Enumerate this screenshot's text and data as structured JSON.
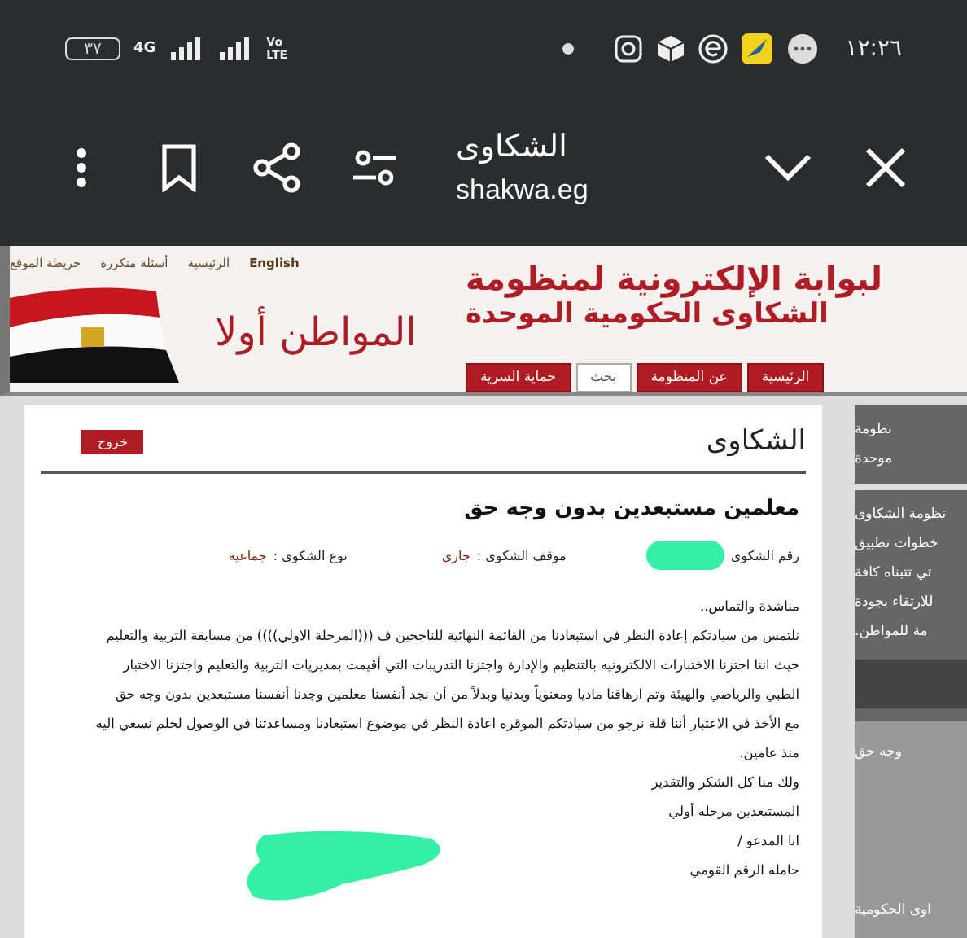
{
  "status_bar": {
    "battery": "٣٧",
    "network": "4G",
    "volte": [
      "Vo",
      "LTE"
    ],
    "time": "١٢:٢٦"
  },
  "browser_bar": {
    "title": "الشكاوى",
    "url": "shakwa.eg"
  },
  "site_header": {
    "top_links": [
      {
        "label": "English",
        "bold": true
      },
      {
        "label": "الرئيسية",
        "bold": false
      },
      {
        "label": "أسئلة متكررة",
        "bold": false
      },
      {
        "label": "خريطة الموقع",
        "bold": false
      }
    ],
    "title_lines": [
      "لبوابة الإلكترونية لمنظومة",
      "الشكاوى الحكومية الموحدة"
    ],
    "slogan": "المواطن أولا",
    "tabs": [
      {
        "label": "الرئيسية",
        "selected": false
      },
      {
        "label": "عن المنظومة",
        "selected": false
      },
      {
        "label": "بحث",
        "selected": true
      },
      {
        "label": "حماية السرية",
        "selected": false
      }
    ]
  },
  "complaint": {
    "heading": "الشكاوى",
    "logout": "خروج",
    "subject": "معلمين مستبعدين بدون وجه حق",
    "number_label": "رقم الشكوى",
    "status_label": "موقف الشكوى :",
    "status": "جاري",
    "type_label": "نوع الشكوى :",
    "type": "جماعية",
    "body_lines": [
      "مناشدة والتماس..",
      "نلتمس من سيادتكم إعادة النظر في استبعادنا من القائمة النهائية للناجحين ف (((المرحلة الاولي)))) من مسابقة التربية والتعليم",
      "حيث اننا اجتزنا الاختبارات الالكترونيه بالتنظيم والإدارة واجتزنا التدريبات التي أقيمت بمديريات التربية والتعليم واجتزنا الاختبار",
      "الطبي والرياضي والهيئة وتم ارهاقنا ماديا ومعنوياً وبدنيا وبدلاً من أن نجد أنفسنا معلمين وجدنا أنفسنا مستبعدين بدون وجه حق",
      "مع الأخذ في الاعتبار أننا قلة نرجو من سيادتكم الموقره اعادة النظر في موضوع استبعادنا ومساعدتنا في الوصول لحلم نسعي اليه",
      "منذ عامين.",
      "ولك منا كل الشكر والتقدير",
      "المستبعدين مرحله أولي",
      "انا المدعو /",
      "حامله الرقم القومي"
    ]
  },
  "sidebar": {
    "heading_lines": [
      "نظومة",
      "موحدة"
    ],
    "text_lines": [
      "نظومة الشكاوى",
      "خطوات تطبيق",
      "تي تتبناه كافة",
      "للارتقاء بجودة",
      "مة للمواطن."
    ],
    "links": [
      "وجه حق"
    ],
    "footer": "اوى الحكومية"
  }
}
